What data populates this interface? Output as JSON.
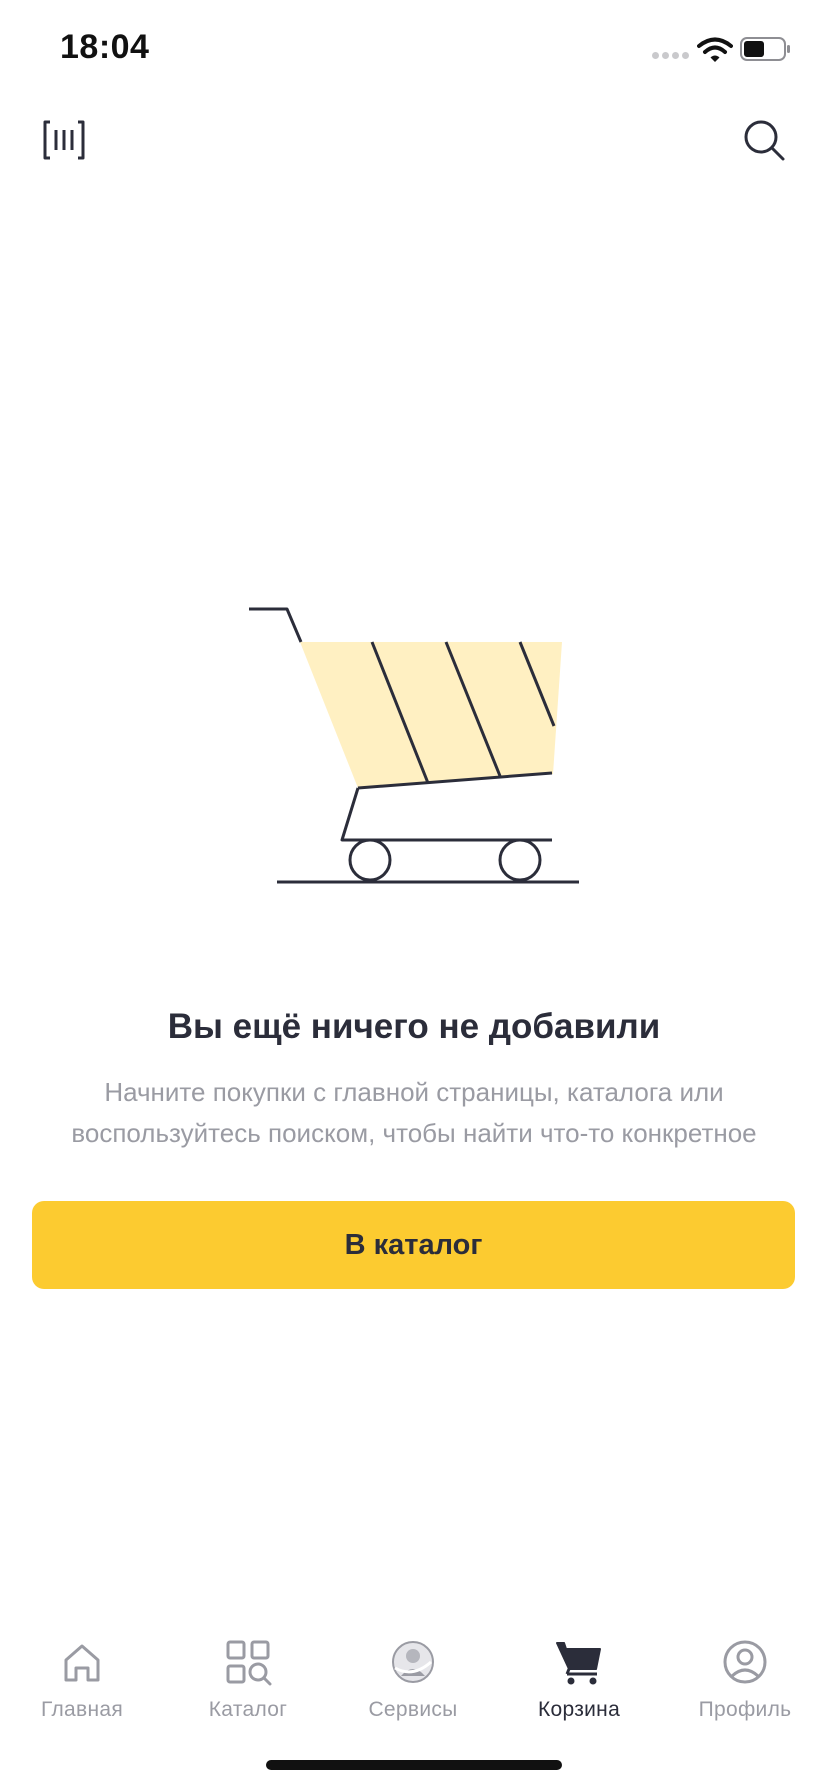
{
  "status_bar": {
    "time": "18:04"
  },
  "header": {
    "scan_icon": "barcode-scan-icon",
    "search_icon": "search-icon"
  },
  "empty_state": {
    "illustration": "shopping-cart-illustration",
    "title": "Вы ещё ничего не добавили",
    "subtitle_line1": "Начните покупки с главной страницы, каталога или",
    "subtitle_line2": "воспользуйтесь поиском, чтобы найти что-то конкретное",
    "button_label": "В каталог"
  },
  "tab_bar": {
    "items": [
      {
        "label": "Главная",
        "icon": "home-icon",
        "active": false
      },
      {
        "label": "Каталог",
        "icon": "catalog-icon",
        "active": false
      },
      {
        "label": "Сервисы",
        "icon": "services-icon",
        "active": false
      },
      {
        "label": "Корзина",
        "icon": "cart-icon",
        "active": true
      },
      {
        "label": "Профиль",
        "icon": "profile-icon",
        "active": false
      }
    ]
  },
  "colors": {
    "accent": "#fccb30",
    "illustration_fill": "#fff0c2",
    "text_primary": "#2b2d3a",
    "text_secondary": "#9a9ba3"
  }
}
